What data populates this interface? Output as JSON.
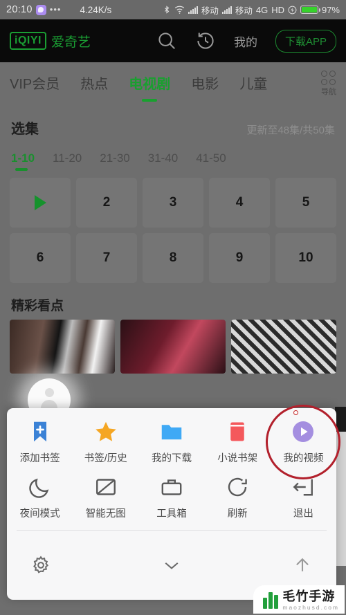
{
  "status_bar": {
    "time": "20:10",
    "app_icon": "app-badge-icon",
    "overflow_dots": "•••",
    "network_speed": "4.24K/s",
    "bluetooth_icon": "bluetooth-icon",
    "wifi_icon": "wifi-icon",
    "signal_icon": "signal-bars-icon",
    "carrier_1": "移动",
    "carrier_2": "移动",
    "network_type": "4G",
    "hd_label": "HD",
    "charging_icon": "charging-bolt-icon",
    "battery_percent": "97%",
    "battery_level": 97,
    "battery_color": "#37d22c"
  },
  "header": {
    "logo_mark": "iQIYI",
    "logo_text": "爱奇艺",
    "logo_color": "#1a9e33",
    "search_icon": "search-icon",
    "history_icon": "history-clock-icon",
    "mine_label": "我的",
    "download_app_label": "下载APP"
  },
  "nav": {
    "tabs": [
      {
        "label": "VIP会员",
        "active": false
      },
      {
        "label": "热点",
        "active": false
      },
      {
        "label": "电视剧",
        "active": true
      },
      {
        "label": "电影",
        "active": false
      },
      {
        "label": "儿童",
        "active": false
      }
    ],
    "grid_label": "导航",
    "active_color": "#19a02f"
  },
  "episodes": {
    "section_title": "选集",
    "section_subtitle": "更新至48集/共50集",
    "ranges": [
      {
        "label": "1-10",
        "active": true
      },
      {
        "label": "11-20",
        "active": false
      },
      {
        "label": "21-30",
        "active": false
      },
      {
        "label": "31-40",
        "active": false
      },
      {
        "label": "41-50",
        "active": false
      }
    ],
    "items": [
      "",
      "2",
      "3",
      "4",
      "5",
      "6",
      "7",
      "8",
      "9",
      "10"
    ],
    "playing_index": 0,
    "play_icon": "play-triangle-icon"
  },
  "highlights": {
    "title": "精彩看点"
  },
  "avatar_bubble": {
    "icon": "person-avatar-icon"
  },
  "menu": {
    "row1": [
      {
        "label": "添加书签",
        "icon": "bookmark-plus-icon",
        "color": "#3b82d6",
        "badge": false,
        "annotated": false
      },
      {
        "label": "书签/历史",
        "icon": "star-icon",
        "color": "#f5a623",
        "badge": false,
        "annotated": false
      },
      {
        "label": "我的下载",
        "icon": "folder-icon",
        "color": "#3fa9f5",
        "badge": false,
        "annotated": false
      },
      {
        "label": "小说书架",
        "icon": "book-icon",
        "color": "#f4585c",
        "badge": false,
        "annotated": false
      },
      {
        "label": "我的视频",
        "icon": "play-circle-icon",
        "color": "#a48ee0",
        "badge": true,
        "annotated": true
      }
    ],
    "row2": [
      {
        "label": "夜间模式",
        "icon": "moon-icon"
      },
      {
        "label": "智能无图",
        "icon": "no-image-icon"
      },
      {
        "label": "工具箱",
        "icon": "toolbox-icon"
      },
      {
        "label": "刷新",
        "icon": "refresh-icon"
      },
      {
        "label": "退出",
        "icon": "exit-icon"
      }
    ],
    "annotation_color": "#b2202c",
    "bottom_bar": {
      "settings_icon": "gear-icon",
      "collapse_icon": "chevron-down-icon",
      "scroll_top_icon": "arrow-up-icon"
    }
  },
  "watermark": {
    "brand": "毛竹手游",
    "site": "maozhusd.com",
    "color": "#22a03c"
  }
}
